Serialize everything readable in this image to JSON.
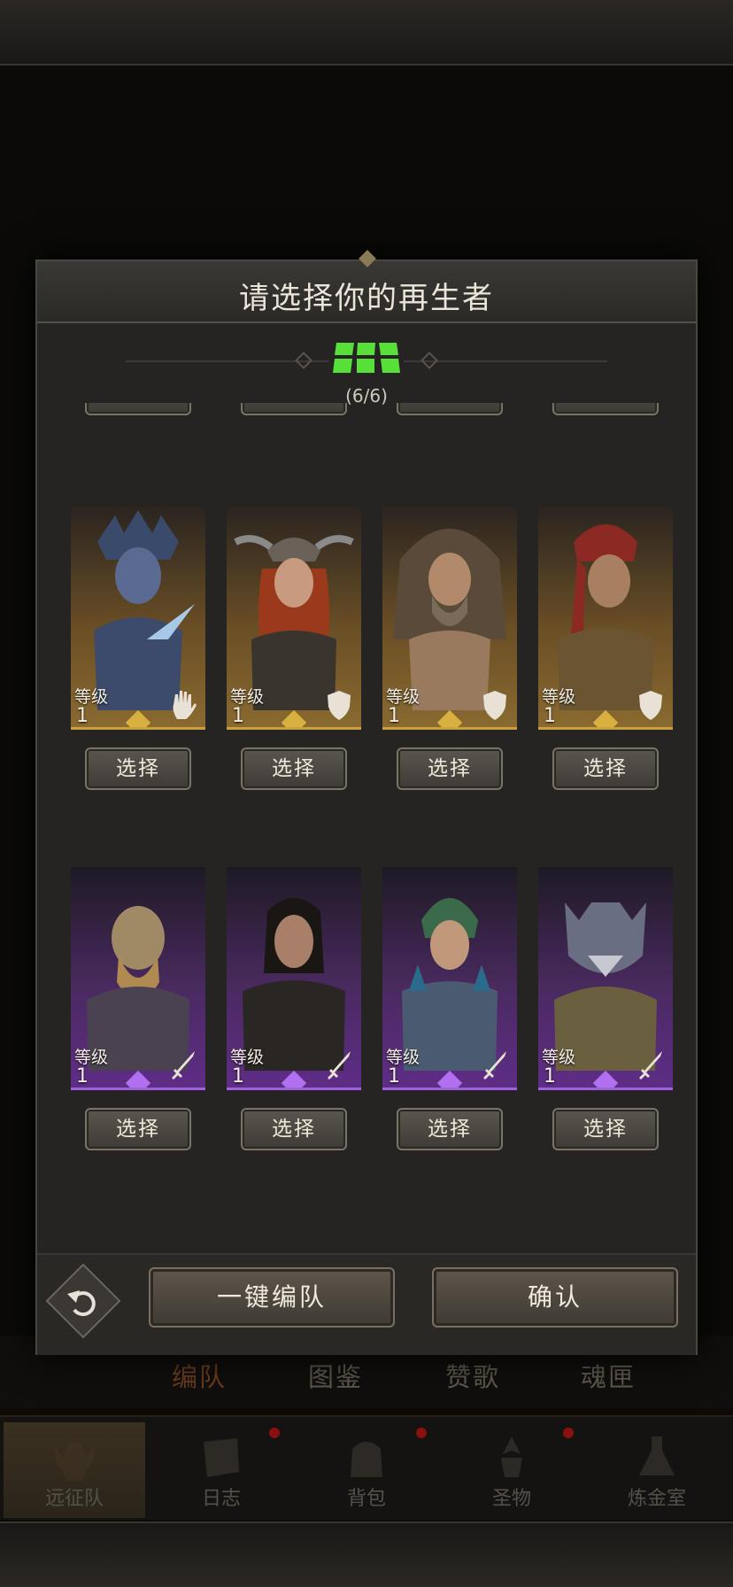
{
  "dialog": {
    "title": "请选择你的再生者",
    "counter": "(6/6)",
    "select_label": "选择",
    "level_label": "等级",
    "auto_team_label": "一键编队",
    "confirm_label": "确认"
  },
  "heroes_gold": [
    {
      "level": "1",
      "role": "hand"
    },
    {
      "level": "1",
      "role": "shield"
    },
    {
      "level": "1",
      "role": "shield"
    },
    {
      "level": "1",
      "role": "shield"
    }
  ],
  "heroes_purple": [
    {
      "level": "1",
      "role": "sword"
    },
    {
      "level": "1",
      "role": "sword"
    },
    {
      "level": "1",
      "role": "sword"
    },
    {
      "level": "1",
      "role": "sword"
    }
  ],
  "sub_tabs": [
    "编队",
    "图鉴",
    "赞歌",
    "魂匣"
  ],
  "nav": [
    "远征队",
    "日志",
    "背包",
    "圣物",
    "炼金室"
  ],
  "colors": {
    "gold_rarity": "#c8a040",
    "purple_rarity": "#a060e0",
    "counter_green": "#58e03a"
  }
}
